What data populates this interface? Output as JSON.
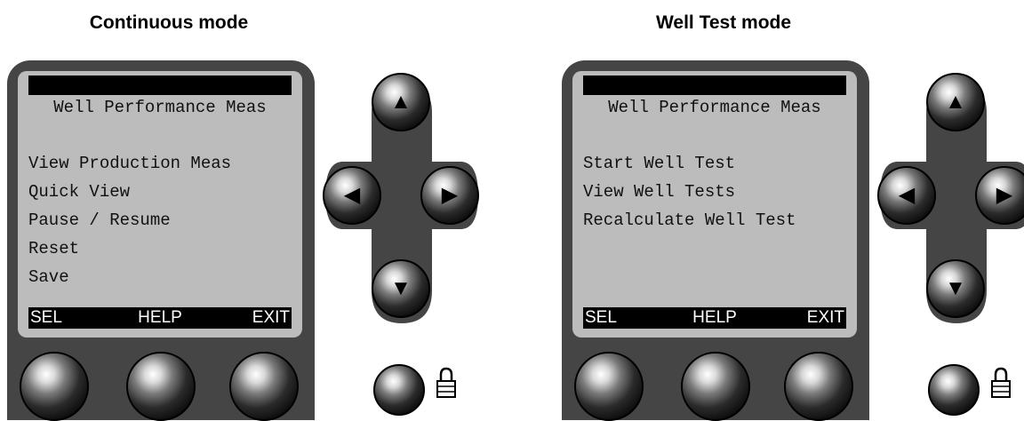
{
  "panels": [
    {
      "title": "Continuous mode",
      "screen_heading": "Well Performance Meas",
      "menu": [
        "View Production Meas",
        "Quick View",
        "Pause / Resume",
        "Reset",
        "Save"
      ],
      "softkeys": {
        "left": "SEL",
        "middle": "HELP",
        "right": "EXIT"
      }
    },
    {
      "title": "Well Test mode",
      "screen_heading": "Well Performance Meas",
      "menu": [
        "Start Well Test",
        "View Well Tests",
        "Recalculate Well Test"
      ],
      "softkeys": {
        "left": "SEL",
        "middle": "HELP",
        "right": "EXIT"
      }
    }
  ],
  "icons": {
    "arrows": [
      "arrow-up-icon",
      "arrow-left-icon",
      "arrow-right-icon",
      "arrow-down-icon"
    ],
    "lock": "padlock-icon"
  },
  "colors": {
    "bezel": "#454545",
    "screen": "#bcbcbc",
    "bar": "#000000",
    "button": "#0a0a0a"
  }
}
